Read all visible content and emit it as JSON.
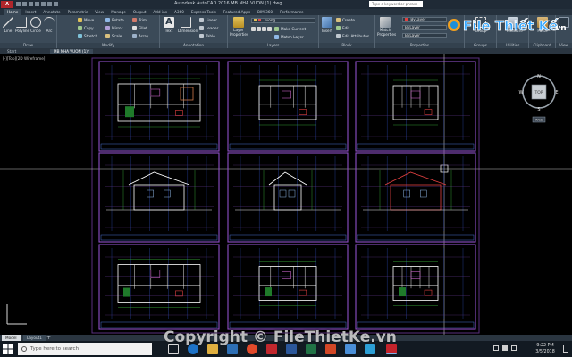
{
  "app": {
    "logo_text": "A",
    "title": "Autodesk AutoCAD 2016    MB NHA VUON (1).dwg",
    "search_placeholder": "Type a keyword or phrase"
  },
  "ribbon_tabs": [
    "Home",
    "Insert",
    "Annotate",
    "Parametric",
    "View",
    "Manage",
    "Output",
    "Add-ins",
    "A360",
    "Express Tools",
    "Featured Apps",
    "BIM 360",
    "Performance"
  ],
  "ribbon": {
    "draw": {
      "label": "Draw",
      "line": "Line",
      "polyline": "Polyline",
      "circle": "Circle",
      "arc": "Arc"
    },
    "modify": {
      "label": "Modify",
      "move": "Move",
      "rotate": "Rotate",
      "trim": "Trim",
      "copy": "Copy",
      "mirror": "Mirror",
      "fillet": "Fillet",
      "stretch": "Stretch",
      "scale": "Scale",
      "array": "Array"
    },
    "annotation": {
      "label": "Annotation",
      "text": "Text",
      "dimension": "Dimension",
      "linear": "Linear",
      "leader": "Leader",
      "table": "Table"
    },
    "layers": {
      "label": "Layers",
      "layer_properties": "Layer Properties",
      "current_layer": "Tuong",
      "make_current": "Make Current",
      "match_layer": "Match Layer"
    },
    "block": {
      "label": "Block",
      "insert": "Insert",
      "create": "Create",
      "edit": "Edit",
      "edit_attributes": "Edit Attributes"
    },
    "properties": {
      "label": "Properties",
      "match": "Match Properties",
      "bylayer_color": "ByLayer",
      "bylayer_lineweight": "ByLayer",
      "bylayer_linetype": "ByLayer"
    },
    "groups": {
      "label": "Groups",
      "group": "Group"
    },
    "utilities": {
      "label": "Utilities",
      "measure": "Measure"
    },
    "clipboard": {
      "label": "Clipboard",
      "paste": "Paste"
    },
    "view": {
      "label": "View"
    }
  },
  "doc_tabs": {
    "start": "Start",
    "file": "MB NHA VUON (1)*"
  },
  "viewport_label": "[-][Top][2D Wireframe]",
  "viewcube": {
    "top": "TOP",
    "n": "N",
    "s": "S",
    "e": "E",
    "w": "W",
    "wcs": "WCS"
  },
  "layout_tabs": {
    "model": "Model",
    "layout1": "Layout1",
    "add": "+"
  },
  "taskbar": {
    "search_placeholder": "Type here to search",
    "time": "9:22 PM",
    "date": "3/5/2018"
  },
  "watermark": {
    "logo_text": "File Thiết Kế",
    "logo_suffix": ".vn",
    "copyright": "Copyright © FileThietKe.vn"
  },
  "colors": {
    "canvas": "#000000",
    "ribbon": "#3b4a58",
    "sheet_border": "#8e4fc7",
    "taskbar": "#121a22"
  }
}
